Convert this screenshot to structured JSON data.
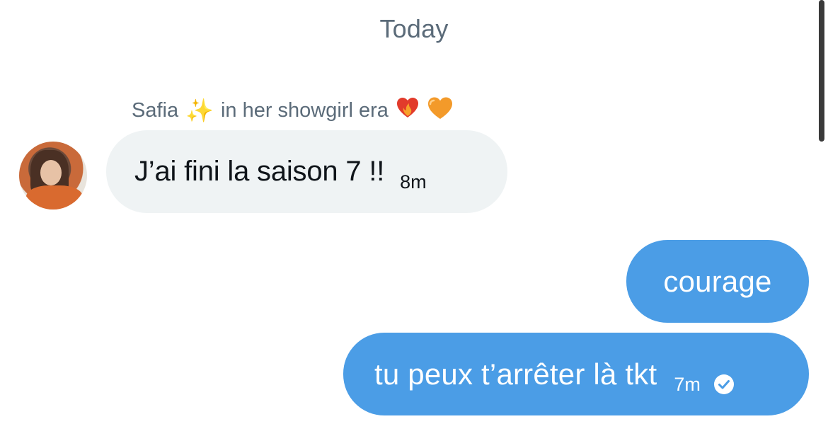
{
  "conversation": {
    "date_separator": "Today"
  },
  "incoming": {
    "sender_name": "Safia",
    "sender_name_suffix": "in her showgirl era",
    "avatar_icon": "user-avatar-photo",
    "message": {
      "text": "J’ai fini la saison 7 !!",
      "time": "8m"
    }
  },
  "outgoing": [
    {
      "text": "courage"
    },
    {
      "text": "tu peux t’arrêter là tkt",
      "time": "7m",
      "status_icon": "check-circle-icon"
    }
  ],
  "colors": {
    "outgoing_bubble": "#4b9de6",
    "incoming_bubble": "#eff3f4",
    "meta_text": "#5b6b79"
  },
  "icons": {
    "sparkles": "sparkles-icon",
    "heart_on_fire": "heart-on-fire-icon",
    "orange_heart": "orange-heart-icon"
  }
}
